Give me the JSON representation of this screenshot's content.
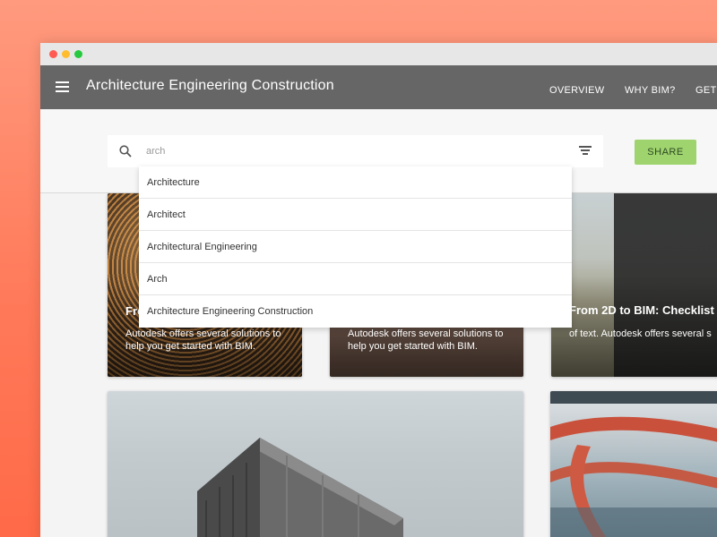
{
  "app": {
    "title": "Architecture Engineering Construction"
  },
  "nav": {
    "items": [
      "OVERVIEW",
      "WHY BIM?",
      "GET STA"
    ]
  },
  "search": {
    "value": "arch",
    "suggestions": [
      "Architecture",
      "Architect",
      "Architectural Engineering",
      "Arch",
      "Architecture Engineering Construction"
    ]
  },
  "actions": {
    "share_label": "SHARE"
  },
  "cards": [
    {
      "title": "Fro",
      "description": "Autodesk offers several solutions to help you get started with BIM."
    },
    {
      "title": "",
      "description": "Autodesk offers several solutions to help you get started with BIM."
    },
    {
      "title": "From 2D to BIM: Checklist",
      "description": "of text. Autodesk offers several s"
    }
  ],
  "colors": {
    "appbar": "#666666",
    "share_button": "#9ed36e",
    "background_gradient": "#ff8a68"
  }
}
